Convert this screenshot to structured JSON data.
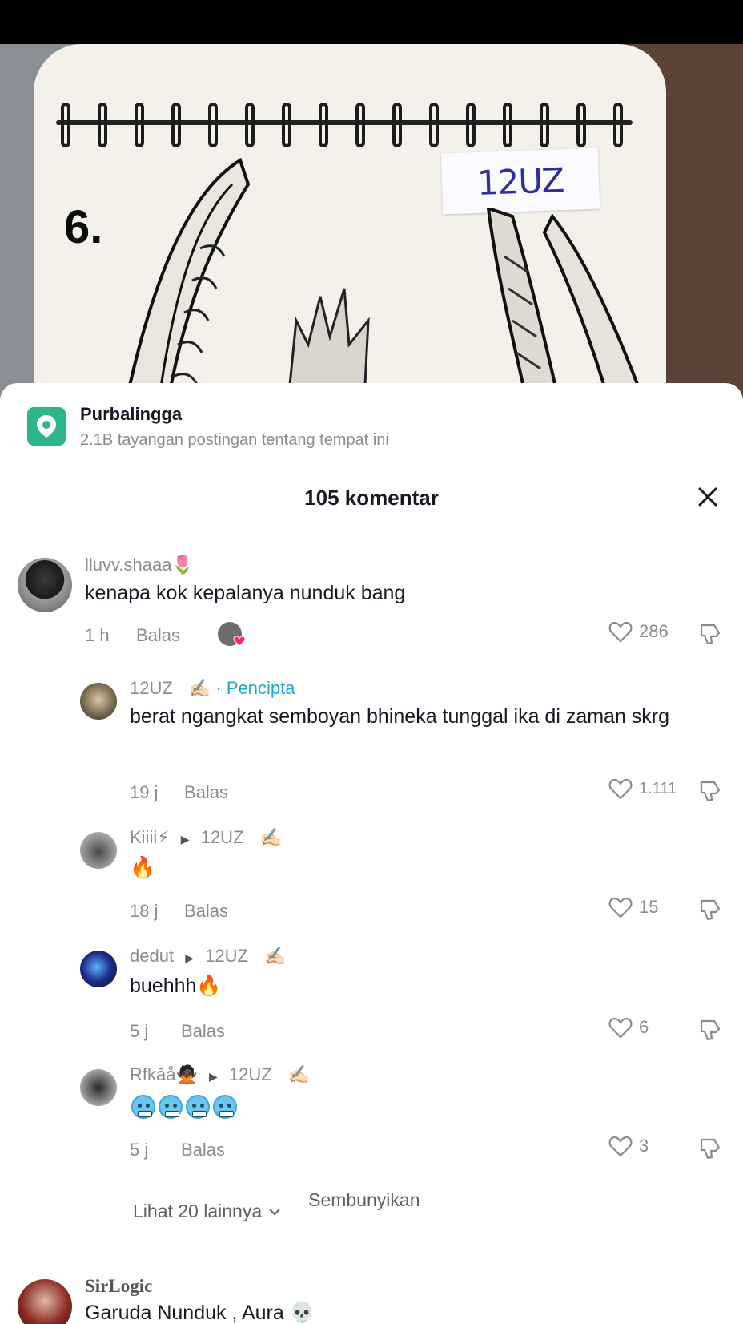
{
  "video": {
    "sketch_number": "6.",
    "sticker_text": "12UZ"
  },
  "location": {
    "name": "Purbalingga",
    "subtitle": "2.1B tayangan postingan tentang tempat ini"
  },
  "comments_header": {
    "title": "105 komentar"
  },
  "comments": [
    {
      "username": "lluvv.shaaa🌷",
      "text": "kenapa kok kepalanya nunduk bang",
      "time": "1 h",
      "reply_label": "Balas",
      "likes": "286"
    }
  ],
  "replies": [
    {
      "username": "12UZ",
      "creator_label": "· Pencipta",
      "text": "berat ngangkat semboyan bhineka tunggal ika di zaman skrg",
      "time": "19 j",
      "reply_label": "Balas",
      "likes": "1.111"
    },
    {
      "username": "Kiiii⚡",
      "reply_to": "12UZ",
      "text": "🔥",
      "time": "18 j",
      "reply_label": "Balas",
      "likes": "15"
    },
    {
      "username": "dedut",
      "reply_to": "12UZ",
      "text": "buehhh🔥",
      "time": "5 j",
      "reply_label": "Balas",
      "likes": "6"
    },
    {
      "username": "Rfkāå🙅🏿",
      "reply_to": "12UZ",
      "text": "",
      "time": "5 j",
      "reply_label": "Balas",
      "likes": "3"
    }
  ],
  "more": {
    "view_more": "Lihat 20 lainnya",
    "hide": "Sembunyikan"
  },
  "next_comment": {
    "username": "SirLogic",
    "text": "Garuda Nunduk , Aura 💀"
  }
}
